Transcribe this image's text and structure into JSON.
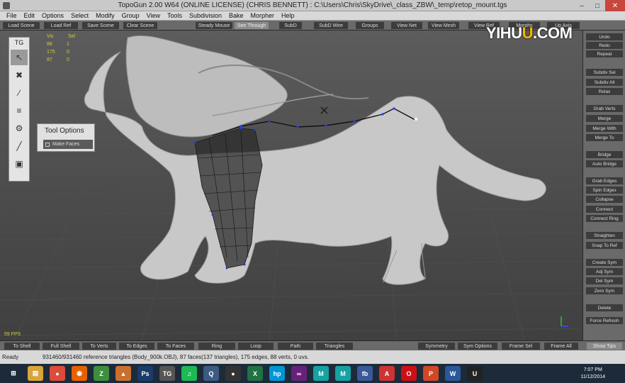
{
  "window": {
    "title": "TopoGun 2.00 W64  (ONLINE LICENSE) (CHRIS BENNETT)  :  C:\\Users\\Chris\\SkyDrive\\_class_ZBW\\_temp\\retop_mount.tgs"
  },
  "menu": [
    "File",
    "Edit",
    "Options",
    "Select",
    "Modify",
    "Group",
    "View",
    "Tools",
    "Subdivision",
    "Bake",
    "Morpher",
    "Help"
  ],
  "toolbar": [
    "Load Scene",
    "Load Ref",
    "Save Scene",
    "Clear Scene",
    "Steady Mouse",
    "See Through",
    "SubD",
    "SubD Wire",
    "Groups",
    "View Net",
    "View Mesh",
    "View Ref",
    "Morphs",
    "Up Axis"
  ],
  "tg_panel": {
    "title": "TG"
  },
  "stats": {
    "header": [
      "",
      "Vis",
      "Sel"
    ],
    "rows": [
      [
        "",
        "88",
        "1"
      ],
      [
        "",
        "175",
        "0"
      ],
      [
        "",
        "87",
        "0"
      ]
    ]
  },
  "tool_options": {
    "title": "Tool Options",
    "button": "Make Faces"
  },
  "fps": "59 FPS",
  "right_panel": [
    "Undo",
    "Redo",
    "Repeat",
    "Subdiv Sel",
    "Subdiv All",
    "Relax",
    "Grab Verts",
    "Merge",
    "Merge With",
    "Merge To",
    "Bridge",
    "Auto Bridge",
    "Grab Edges",
    "Spin Edges",
    "Collapse",
    "Connect",
    "Connect Ring",
    "Straighten",
    "Snap To Ref",
    "Create Sym",
    "Adj Sym",
    "Del Sym",
    "Zero Sym",
    "Delete",
    "Force Refresh"
  ],
  "bottom_bar": [
    "To Shell",
    "Full Shell",
    "To Verts",
    "To Edges",
    "To Faces",
    "Ring",
    "Loop",
    "Path",
    "Triangles",
    "Symmetry",
    "Sym Options",
    "Frame Sel",
    "Frame All",
    "Show Tips"
  ],
  "status": {
    "ready": "Ready",
    "info": "931460/931460 reference triangles (Body_900k.OBJ), 87 faces(137 triangles), 175 edges, 88 verts, 0 uvs."
  },
  "watermark": {
    "pre": "YIHU",
    "u": "U",
    "post": ".COM"
  },
  "taskbar": {
    "icons": [
      "windows-start-icon",
      "file-explorer-icon",
      "chrome-icon",
      "firefox-icon",
      "zbrush-icon",
      "sidefx-icon",
      "photoshop-icon",
      "topogun-icon",
      "spotify-icon",
      "quicktime-icon",
      "obs-icon",
      "excel-icon",
      "hp-icon",
      "vs-icon",
      "maya-icon",
      "maya2-icon",
      "fb-icon",
      "adobe-icon",
      "opera-icon",
      "powerpoint-icon",
      "word-icon",
      "unreal-icon"
    ],
    "time": "7:07 PM",
    "date": "11/12/2014"
  },
  "colors": {
    "accent_yellow": "#d0d040",
    "net_blue": "#1e3cff",
    "mesh_dark": "#2c2c2c"
  }
}
